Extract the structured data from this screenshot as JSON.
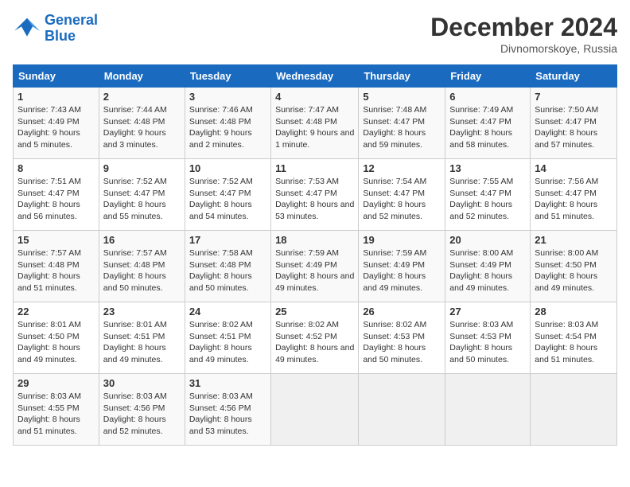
{
  "logo": {
    "general": "General",
    "blue": "Blue"
  },
  "header": {
    "month_year": "December 2024",
    "location": "Divnomorskoye, Russia"
  },
  "days_of_week": [
    "Sunday",
    "Monday",
    "Tuesday",
    "Wednesday",
    "Thursday",
    "Friday",
    "Saturday"
  ],
  "weeks": [
    [
      {
        "num": "1",
        "rise": "7:43 AM",
        "set": "4:49 PM",
        "daylight": "9 hours and 5 minutes."
      },
      {
        "num": "2",
        "rise": "7:44 AM",
        "set": "4:48 PM",
        "daylight": "9 hours and 3 minutes."
      },
      {
        "num": "3",
        "rise": "7:46 AM",
        "set": "4:48 PM",
        "daylight": "9 hours and 2 minutes."
      },
      {
        "num": "4",
        "rise": "7:47 AM",
        "set": "4:48 PM",
        "daylight": "9 hours and 1 minute."
      },
      {
        "num": "5",
        "rise": "7:48 AM",
        "set": "4:47 PM",
        "daylight": "8 hours and 59 minutes."
      },
      {
        "num": "6",
        "rise": "7:49 AM",
        "set": "4:47 PM",
        "daylight": "8 hours and 58 minutes."
      },
      {
        "num": "7",
        "rise": "7:50 AM",
        "set": "4:47 PM",
        "daylight": "8 hours and 57 minutes."
      }
    ],
    [
      {
        "num": "8",
        "rise": "7:51 AM",
        "set": "4:47 PM",
        "daylight": "8 hours and 56 minutes."
      },
      {
        "num": "9",
        "rise": "7:52 AM",
        "set": "4:47 PM",
        "daylight": "8 hours and 55 minutes."
      },
      {
        "num": "10",
        "rise": "7:52 AM",
        "set": "4:47 PM",
        "daylight": "8 hours and 54 minutes."
      },
      {
        "num": "11",
        "rise": "7:53 AM",
        "set": "4:47 PM",
        "daylight": "8 hours and 53 minutes."
      },
      {
        "num": "12",
        "rise": "7:54 AM",
        "set": "4:47 PM",
        "daylight": "8 hours and 52 minutes."
      },
      {
        "num": "13",
        "rise": "7:55 AM",
        "set": "4:47 PM",
        "daylight": "8 hours and 52 minutes."
      },
      {
        "num": "14",
        "rise": "7:56 AM",
        "set": "4:47 PM",
        "daylight": "8 hours and 51 minutes."
      }
    ],
    [
      {
        "num": "15",
        "rise": "7:57 AM",
        "set": "4:48 PM",
        "daylight": "8 hours and 51 minutes."
      },
      {
        "num": "16",
        "rise": "7:57 AM",
        "set": "4:48 PM",
        "daylight": "8 hours and 50 minutes."
      },
      {
        "num": "17",
        "rise": "7:58 AM",
        "set": "4:48 PM",
        "daylight": "8 hours and 50 minutes."
      },
      {
        "num": "18",
        "rise": "7:59 AM",
        "set": "4:49 PM",
        "daylight": "8 hours and 49 minutes."
      },
      {
        "num": "19",
        "rise": "7:59 AM",
        "set": "4:49 PM",
        "daylight": "8 hours and 49 minutes."
      },
      {
        "num": "20",
        "rise": "8:00 AM",
        "set": "4:49 PM",
        "daylight": "8 hours and 49 minutes."
      },
      {
        "num": "21",
        "rise": "8:00 AM",
        "set": "4:50 PM",
        "daylight": "8 hours and 49 minutes."
      }
    ],
    [
      {
        "num": "22",
        "rise": "8:01 AM",
        "set": "4:50 PM",
        "daylight": "8 hours and 49 minutes."
      },
      {
        "num": "23",
        "rise": "8:01 AM",
        "set": "4:51 PM",
        "daylight": "8 hours and 49 minutes."
      },
      {
        "num": "24",
        "rise": "8:02 AM",
        "set": "4:51 PM",
        "daylight": "8 hours and 49 minutes."
      },
      {
        "num": "25",
        "rise": "8:02 AM",
        "set": "4:52 PM",
        "daylight": "8 hours and 49 minutes."
      },
      {
        "num": "26",
        "rise": "8:02 AM",
        "set": "4:53 PM",
        "daylight": "8 hours and 50 minutes."
      },
      {
        "num": "27",
        "rise": "8:03 AM",
        "set": "4:53 PM",
        "daylight": "8 hours and 50 minutes."
      },
      {
        "num": "28",
        "rise": "8:03 AM",
        "set": "4:54 PM",
        "daylight": "8 hours and 51 minutes."
      }
    ],
    [
      {
        "num": "29",
        "rise": "8:03 AM",
        "set": "4:55 PM",
        "daylight": "8 hours and 51 minutes."
      },
      {
        "num": "30",
        "rise": "8:03 AM",
        "set": "4:56 PM",
        "daylight": "8 hours and 52 minutes."
      },
      {
        "num": "31",
        "rise": "8:03 AM",
        "set": "4:56 PM",
        "daylight": "8 hours and 53 minutes."
      },
      null,
      null,
      null,
      null
    ]
  ]
}
